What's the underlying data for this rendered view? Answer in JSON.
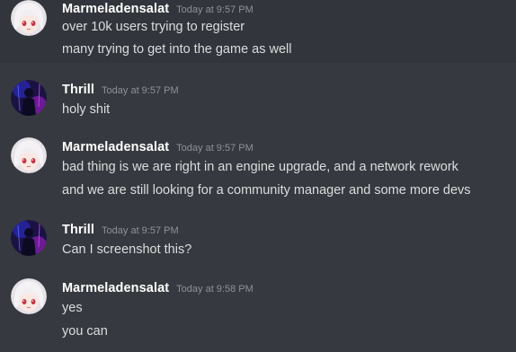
{
  "messages": [
    {
      "author": "Marmeladensalat",
      "timestamp": "Today at 9:57 PM",
      "avatar": "anime-girl-avatar",
      "lines": [
        "over 10k users trying to register",
        "many trying to get into the game as well"
      ]
    },
    {
      "author": "Thrill",
      "timestamp": "Today at 9:57 PM",
      "avatar": "neon-figure-avatar",
      "lines": [
        "holy shit"
      ]
    },
    {
      "author": "Marmeladensalat",
      "timestamp": "Today at 9:57 PM",
      "avatar": "anime-girl-avatar",
      "lines": [
        "bad thing is we are right in an engine upgrade, and a network rework",
        "and we are still looking for a community manager and some more devs"
      ]
    },
    {
      "author": "Thrill",
      "timestamp": "Today at 9:57 PM",
      "avatar": "neon-figure-avatar",
      "lines": [
        "Can I screenshot this?"
      ]
    },
    {
      "author": "Marmeladensalat",
      "timestamp": "Today at 9:58 PM",
      "avatar": "anime-girl-avatar",
      "lines": [
        "yes",
        "you can"
      ]
    }
  ],
  "colors": {
    "background": "#36393f",
    "hover": "#32353b",
    "author": "#ffffff",
    "text": "#dcddde",
    "timestamp": "#8e9297"
  }
}
